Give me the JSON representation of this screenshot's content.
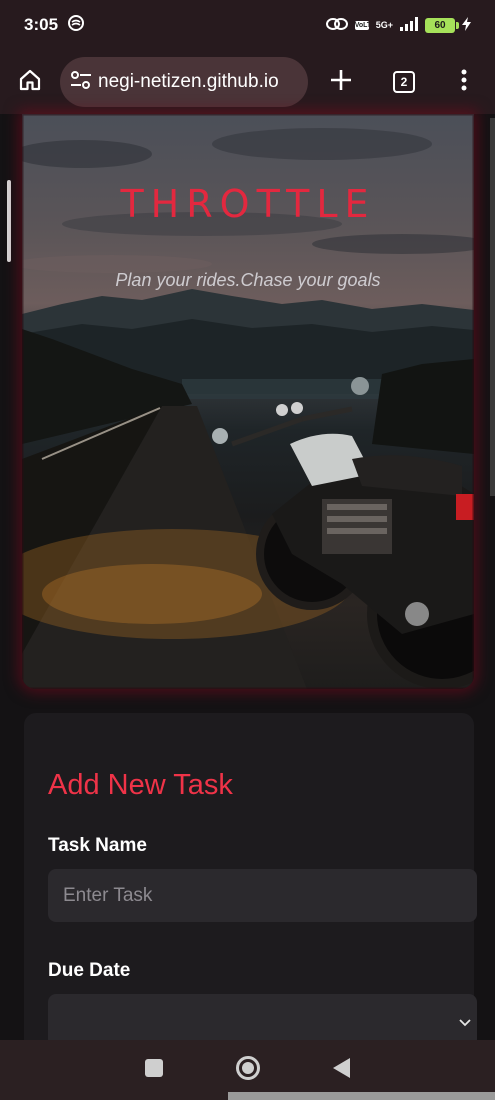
{
  "status_bar": {
    "time": "3:05",
    "network": "5G+",
    "volte": "VoLTE",
    "battery": "60"
  },
  "browser": {
    "url": "negi-netizen.github.io",
    "tab_count": "2"
  },
  "hero": {
    "title": "THROTTLE",
    "tagline": "Plan your rides.Chase your goals"
  },
  "form": {
    "heading": "Add New Task",
    "task_name_label": "Task Name",
    "task_placeholder": "Enter Task",
    "due_date_label": "Due Date",
    "due_date_value": ""
  },
  "colors": {
    "accent": "#ef3348",
    "title_red": "#e3283f",
    "card_bg": "#1d1b1e",
    "input_bg": "#2b292d",
    "chrome_bg": "#271a1e"
  },
  "icons": {
    "home": "home-icon",
    "site_settings": "tune-icon",
    "new_tab": "plus-icon",
    "menu": "more-vert-icon",
    "dropdown": "chevron-down-icon",
    "nav_recents": "square-icon",
    "nav_home": "circle-icon",
    "nav_back": "triangle-back-icon"
  }
}
